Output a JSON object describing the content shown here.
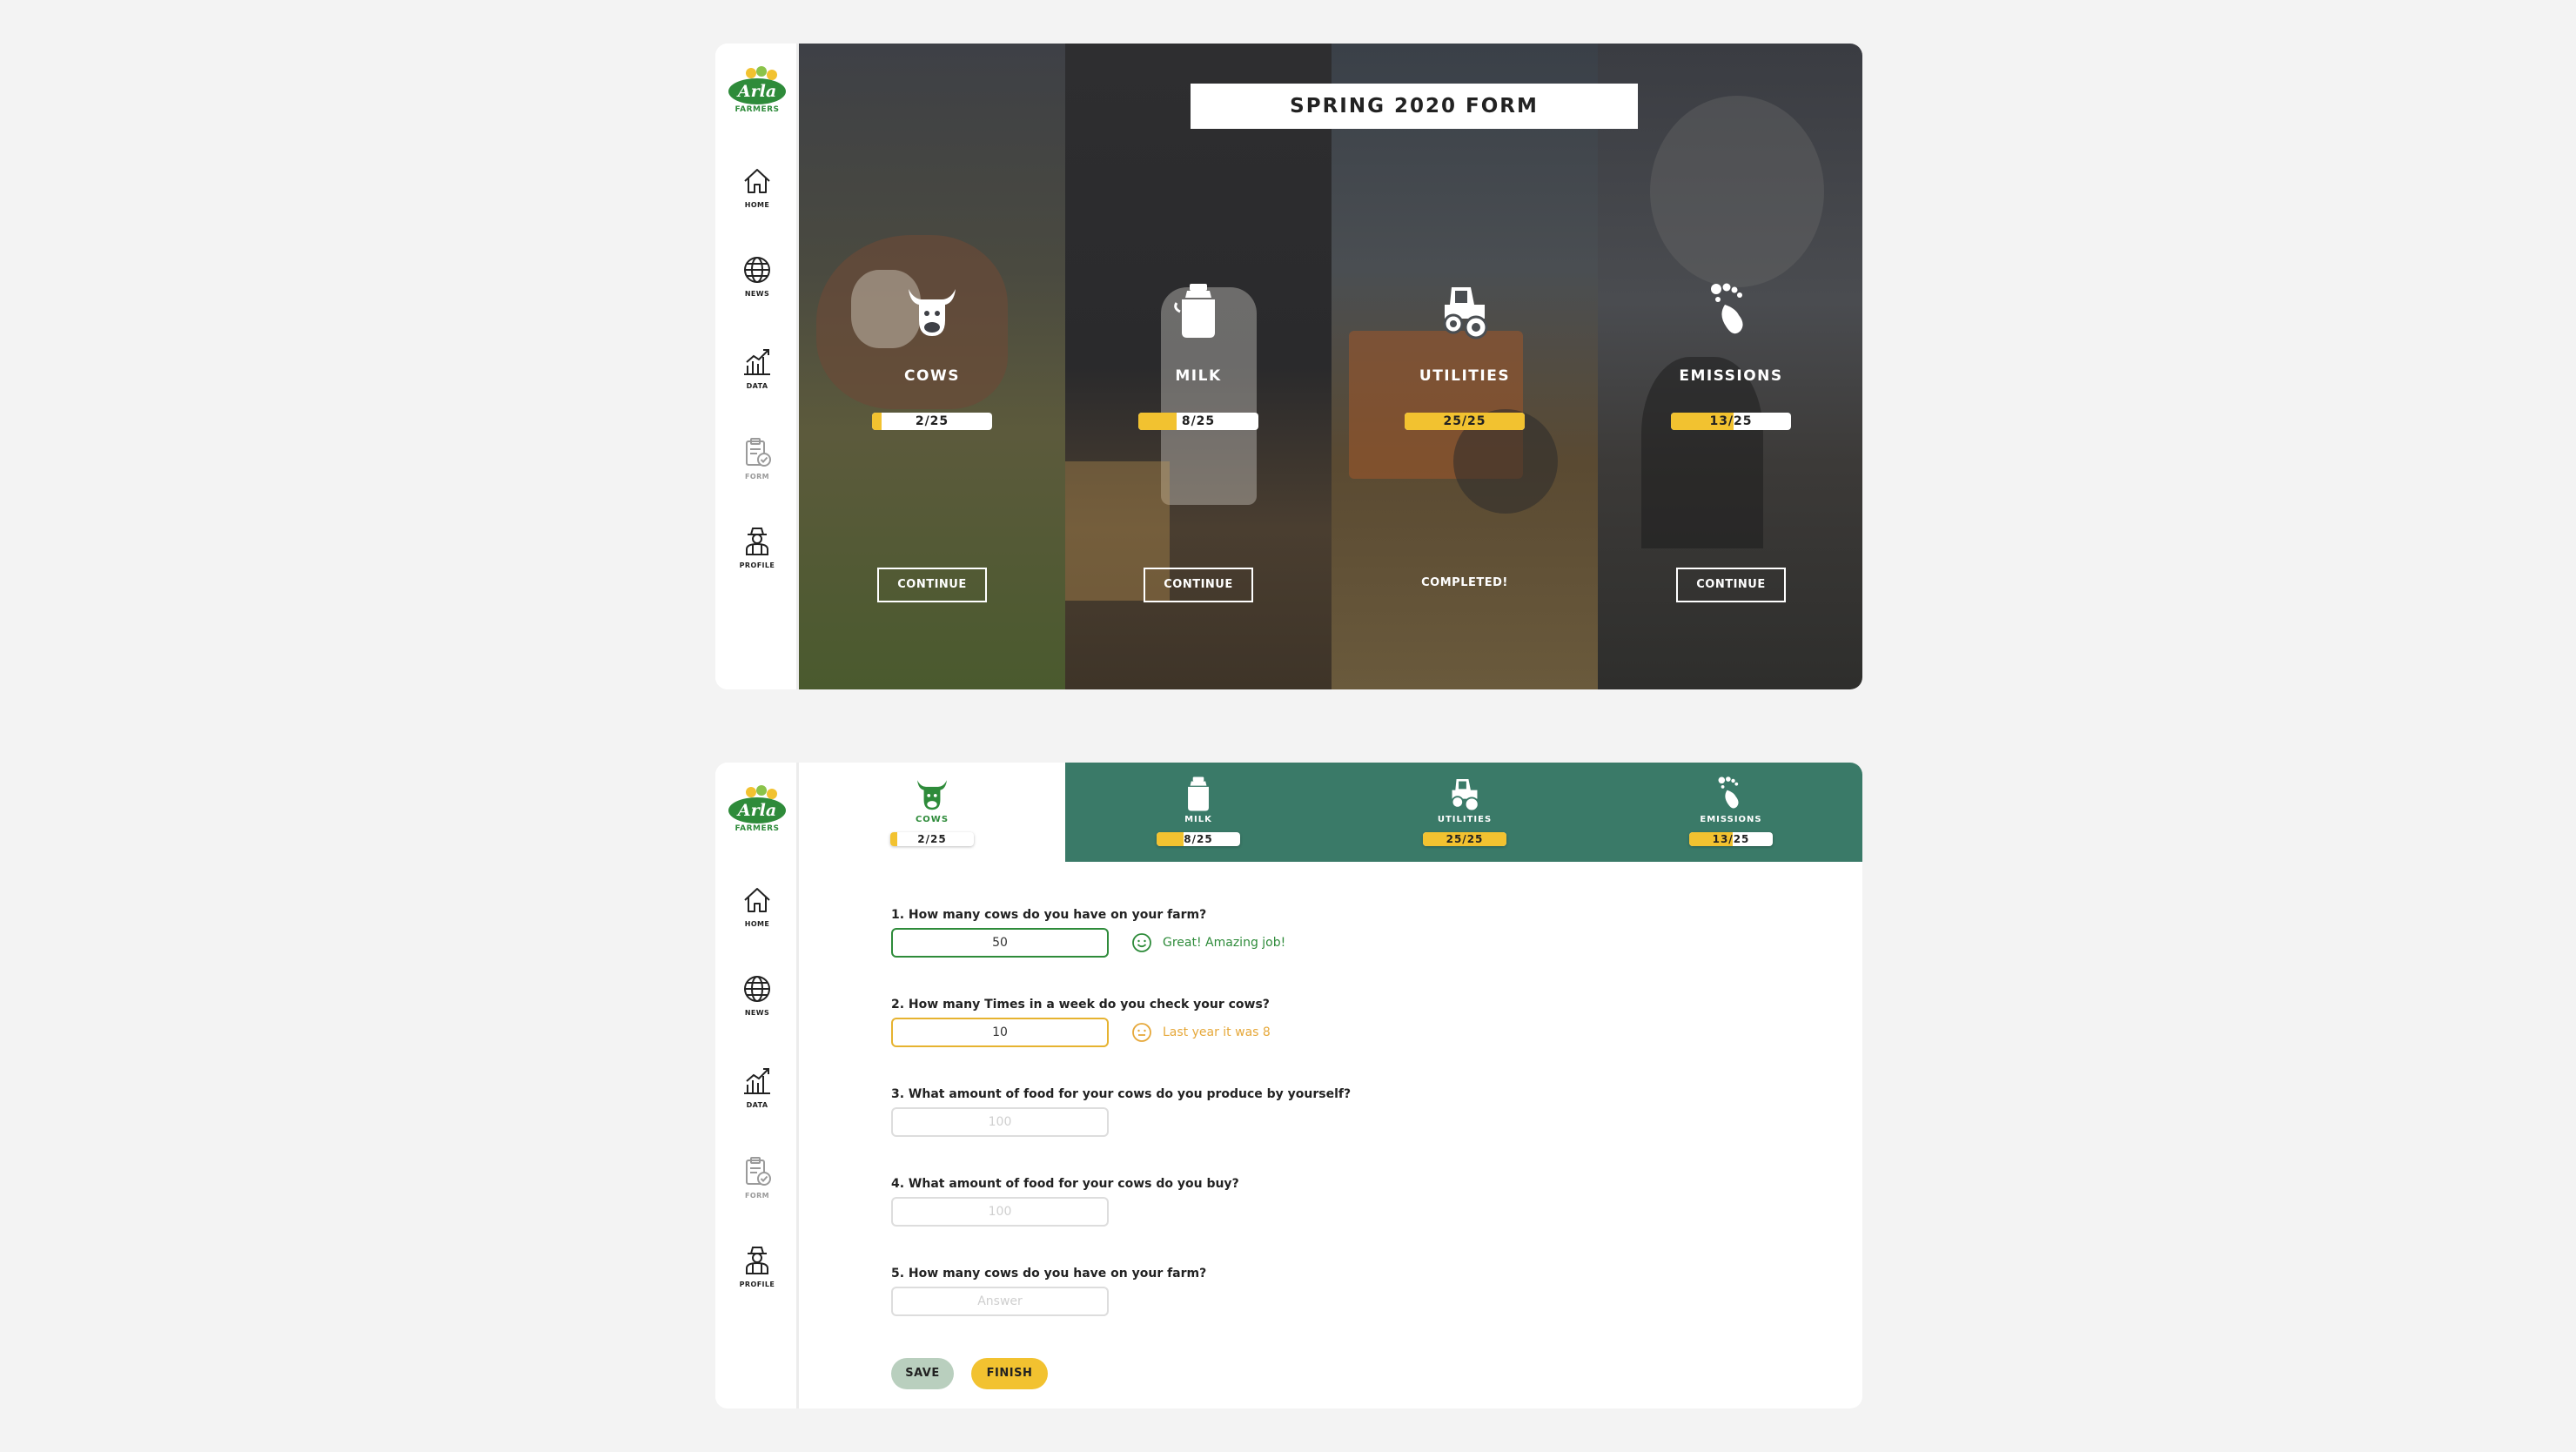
{
  "brand": {
    "logo_text": "Arla",
    "logo_sub": "FARMERS",
    "green": "#2e8b3a",
    "yellow": "#f2c230",
    "tab_green": "#3a7a68"
  },
  "nav": [
    {
      "label": "HOME",
      "icon": "home-icon"
    },
    {
      "label": "NEWS",
      "icon": "globe-icon"
    },
    {
      "label": "DATA",
      "icon": "chart-icon"
    },
    {
      "label": "FORM",
      "icon": "clipboard-check-icon",
      "active": true
    },
    {
      "label": "PROFILE",
      "icon": "farmer-icon"
    }
  ],
  "overview": {
    "title": "SPRING 2020 FORM",
    "sections": [
      {
        "name": "COWS",
        "icon": "cow-icon",
        "progress": "2/25",
        "done": 2,
        "total": 25,
        "action": "CONTINUE"
      },
      {
        "name": "MILK",
        "icon": "milk-can-icon",
        "progress": "8/25",
        "done": 8,
        "total": 25,
        "action": "CONTINUE"
      },
      {
        "name": "UTILITIES",
        "icon": "tractor-icon",
        "progress": "25/25",
        "done": 25,
        "total": 25,
        "status": "COMPLETED!"
      },
      {
        "name": "EMISSIONS",
        "icon": "footprint-icon",
        "progress": "13/25",
        "done": 13,
        "total": 25,
        "action": "CONTINUE"
      }
    ]
  },
  "form": {
    "tabs": [
      {
        "name": "COWS",
        "progress": "2/25",
        "done": 2,
        "total": 25,
        "active": true
      },
      {
        "name": "MILK",
        "progress": "8/25",
        "done": 8,
        "total": 25
      },
      {
        "name": "UTILITIES",
        "progress": "25/25",
        "done": 25,
        "total": 25
      },
      {
        "name": "EMISSIONS",
        "progress": "13/25",
        "done": 13,
        "total": 25
      }
    ],
    "questions": [
      {
        "text": "1. How many cows do you have on your farm?",
        "value": "50",
        "placeholder": "",
        "feedback": "Great! Amazing job!",
        "state": "good"
      },
      {
        "text": "2. How many Times in a week do you check your cows?",
        "value": "10",
        "placeholder": "",
        "feedback": "Last year it was 8",
        "state": "warn"
      },
      {
        "text": "3. What amount of food for your cows do you produce by yourself?",
        "value": "",
        "placeholder": "100"
      },
      {
        "text": "4. What amount of food for your cows do you buy?",
        "value": "",
        "placeholder": "100"
      },
      {
        "text": "5. How many cows do you have on your farm?",
        "value": "",
        "placeholder": "Answer"
      }
    ],
    "save_label": "SAVE",
    "finish_label": "FINISH"
  }
}
